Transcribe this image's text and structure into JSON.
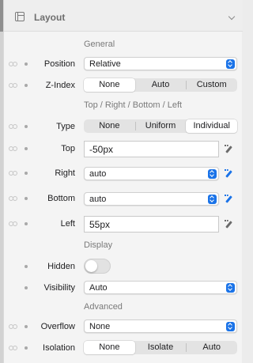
{
  "header": {
    "title": "Layout",
    "icon": "layout-icon"
  },
  "sections": {
    "general": "General",
    "trbl": "Top / Right / Bottom / Left",
    "display": "Display",
    "advanced": "Advanced"
  },
  "position": {
    "label": "Position",
    "value": "Relative"
  },
  "zindex": {
    "label": "Z-Index",
    "options": [
      "None",
      "Auto",
      "Custom"
    ],
    "selected": "None"
  },
  "type": {
    "label": "Type",
    "options": [
      "None",
      "Uniform",
      "Individual"
    ],
    "selected": "Individual"
  },
  "top": {
    "label": "Top",
    "value": "-50px"
  },
  "right": {
    "label": "Right",
    "value": "auto"
  },
  "bottom": {
    "label": "Bottom",
    "value": "auto"
  },
  "left": {
    "label": "Left",
    "value": "55px"
  },
  "hidden": {
    "label": "Hidden",
    "on": false
  },
  "visibility": {
    "label": "Visibility",
    "value": "Auto"
  },
  "overflow": {
    "label": "Overflow",
    "value": "None"
  },
  "isolation": {
    "label": "Isolation",
    "options": [
      "None",
      "Isolate",
      "Auto"
    ],
    "selected": "None"
  },
  "colors": {
    "accent": "#1a73e8",
    "panel": "#f4f4f4",
    "segment": "#e3e3e3"
  }
}
